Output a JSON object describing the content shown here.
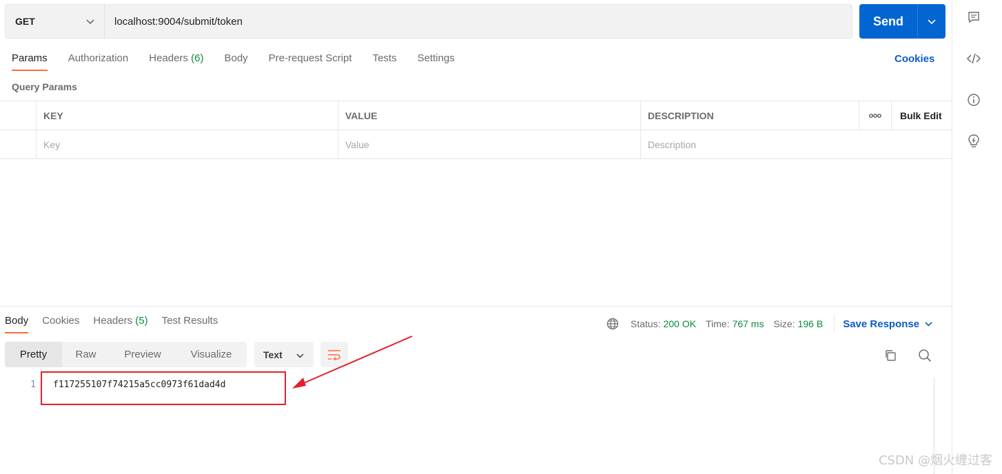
{
  "request": {
    "method": "GET",
    "url": "localhost:9004/submit/token",
    "send_label": "Send"
  },
  "request_tabs": [
    {
      "label": "Params",
      "count": ""
    },
    {
      "label": "Authorization",
      "count": ""
    },
    {
      "label": "Headers",
      "count": "(6)"
    },
    {
      "label": "Body",
      "count": ""
    },
    {
      "label": "Pre-request Script",
      "count": ""
    },
    {
      "label": "Tests",
      "count": ""
    },
    {
      "label": "Settings",
      "count": ""
    }
  ],
  "cookies_label": "Cookies",
  "query_params": {
    "title": "Query Params",
    "headers": {
      "key": "KEY",
      "value": "VALUE",
      "description": "DESCRIPTION",
      "more": "ooo",
      "bulk_edit": "Bulk Edit"
    },
    "placeholders": {
      "key": "Key",
      "value": "Value",
      "description": "Description"
    }
  },
  "response": {
    "tabs": [
      {
        "label": "Body",
        "count": ""
      },
      {
        "label": "Cookies",
        "count": ""
      },
      {
        "label": "Headers",
        "count": "(5)"
      },
      {
        "label": "Test Results",
        "count": ""
      }
    ],
    "status_label": "Status:",
    "status_value": "200 OK",
    "time_label": "Time:",
    "time_value": "767 ms",
    "size_label": "Size:",
    "size_value": "196 B",
    "save_label": "Save Response",
    "views": [
      "Pretty",
      "Raw",
      "Preview",
      "Visualize"
    ],
    "format": "Text",
    "lines": [
      {
        "num": "1",
        "text": "f117255107f74215a5cc0973f61dad4d"
      }
    ]
  },
  "watermark": "CSDN @烟火缠过客",
  "colors": {
    "accent_orange": "#ff6c37",
    "send_blue": "#0265d2",
    "link_blue": "#0b5dc2",
    "status_green": "#0b8a3e",
    "annotation_red": "#e3202a"
  }
}
